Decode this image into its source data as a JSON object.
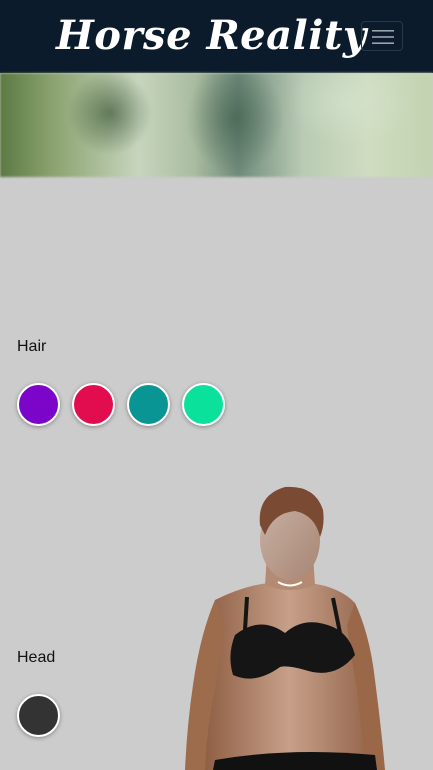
{
  "header": {
    "brand": "Horse Reality",
    "menu_icon": "hamburger-menu-icon"
  },
  "sections": {
    "hair": {
      "label": "Hair",
      "swatches": [
        "#7b05c9",
        "#e20d4f",
        "#0a9595",
        "#0ae19a"
      ]
    },
    "head": {
      "label": "Head",
      "swatches": [
        "#333333"
      ]
    }
  },
  "colors": {
    "navbar": "#0b1b2b",
    "page_background": "#cccccc",
    "skin": "#b07e5f",
    "bra": "#151515"
  }
}
